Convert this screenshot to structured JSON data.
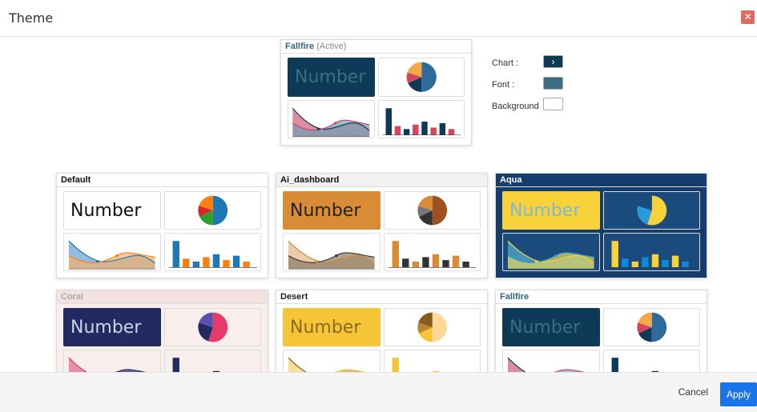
{
  "dialog": {
    "title": "Theme"
  },
  "active": {
    "name": "Fallfire",
    "suffix": "(Active)"
  },
  "settings": {
    "chart_label": "Chart :",
    "font_label": "Font :",
    "background_label": "Background",
    "chart_color": "#0d3a56",
    "font_color": "#3a6e80",
    "background_color": "#ffffff",
    "chart_swatch_glyph": "›"
  },
  "number_label": "Number",
  "themes": [
    {
      "name": "Default",
      "titleBg": "#ffffff",
      "titleColor": "#111111",
      "cardBg": "#ffffff",
      "cellBg": "#ffffff",
      "numBg": "#ffffff",
      "numColor": "#111111",
      "pie": [
        "#1f77b4",
        "#2ca02c",
        "#d62728",
        "#ff7f0e"
      ],
      "bars": [
        "#1f77b4",
        "#ff7f0e"
      ],
      "areaA": "#7fb0d9",
      "areaB": "#f5b16a",
      "lineA": "#1f77b4",
      "lineB": "#ff7f0e"
    },
    {
      "name": "Ai_dashboard",
      "titleBg": "#f1f1f1",
      "titleColor": "#111111",
      "cardBg": "#ffffff",
      "cellBg": "#ffffff",
      "numBg": "#d98b36",
      "numColor": "#222222",
      "pie": [
        "#a0521e",
        "#333333",
        "#777777",
        "#d98b36"
      ],
      "bars": [
        "#d98b36",
        "#333333"
      ],
      "areaA": "#e5c39a",
      "areaB": "#8a7a66",
      "lineA": "#d98b36",
      "lineB": "#333333"
    },
    {
      "name": "Aqua",
      "titleBg": "#143d6c",
      "titleColor": "#ffffff",
      "cardBg": "#143d6c",
      "cellBg": "#1b4a7d",
      "numBg": "#f7d23a",
      "numColor": "#7fb7d9",
      "pie": [
        "#f7d23a",
        "#2a9bd8",
        "#1b4a7d"
      ],
      "bars": [
        "#f7d23a",
        "#0f8ad6"
      ],
      "areaA": "#4fa0c0",
      "areaB": "#e8d95a",
      "lineA": "#f7d23a",
      "lineB": "#2a9bd8"
    },
    {
      "name": "Coral",
      "titleBg": "#f3e2df",
      "titleColor": "#aaaaaa",
      "cardBg": "#f8eeec",
      "cellBg": "#f8eeec",
      "numBg": "#232a62",
      "numColor": "#cfd3e8",
      "pie": [
        "#e63a6a",
        "#232a62",
        "#5a50b0"
      ],
      "bars": [
        "#232a62",
        "#e63a6a"
      ],
      "areaA": "#e07f9a",
      "areaB": "#232a62",
      "lineA": "#e63a6a",
      "lineB": "#232a62"
    },
    {
      "name": "Desert",
      "titleBg": "#ffffff",
      "titleColor": "#222222",
      "cardBg": "#ffffff",
      "cellBg": "#ffffff",
      "numBg": "#f5c537",
      "numColor": "#8a6a1c",
      "pie": [
        "#ffd89a",
        "#f5c537",
        "#b8862e",
        "#8a5a1a"
      ],
      "bars": [
        "#f5c537",
        "#8a5a1a"
      ],
      "areaA": "#f6dc86",
      "areaB": "#c69a56",
      "lineA": "#8a5a1a",
      "lineB": "#f5c537"
    },
    {
      "name": "Fallfire",
      "titleBg": "#ffffff",
      "titleColor": "#336680",
      "cardBg": "#ffffff",
      "cellBg": "#ffffff",
      "numBg": "#0d3a56",
      "numColor": "#3a6e80",
      "pie": [
        "#2e6a9c",
        "#0d3a56",
        "#d6445f",
        "#f2a946"
      ],
      "bars": [
        "#0d3a56",
        "#d6445f"
      ],
      "areaA": "#d47a8e",
      "areaB": "#6ea0b8",
      "lineA": "#0d3a56",
      "lineB": "#d6445f"
    }
  ]
}
